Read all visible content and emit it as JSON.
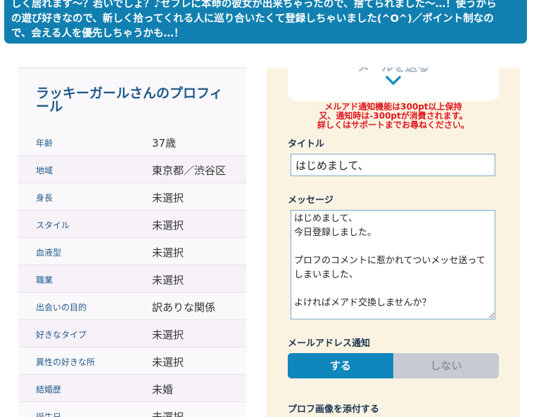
{
  "banner": {
    "line1": "しく居れます〜？若いでしょ？♪セフレに本命の彼女が出来ちゃったので、捨てられました〜…！使うから",
    "line2": "の遊び好きなので、新しく拾ってくれる人に巡り合いたくて登録しちゃいました(^O^)／ポイント制なの",
    "line3": "で、会える人を優先しちゃうかも…！"
  },
  "profile": {
    "heading": "ラッキーガールさんのプロフィール",
    "rows": [
      {
        "key": "年齢",
        "value": "37歳"
      },
      {
        "key": "地域",
        "value": "東京都／渋谷区"
      },
      {
        "key": "身長",
        "value": "未選択"
      },
      {
        "key": "スタイル",
        "value": "未選択"
      },
      {
        "key": "血液型",
        "value": "未選択"
      },
      {
        "key": "職業",
        "value": "未選択"
      },
      {
        "key": "出会いの目的",
        "value": "訳ありな関係"
      },
      {
        "key": "好きなタイプ",
        "value": "未選択"
      },
      {
        "key": "異性の好きな所",
        "value": "未選択"
      },
      {
        "key": "結婚歴",
        "value": "未婚"
      },
      {
        "key": "誕生日",
        "value": "未選択"
      }
    ]
  },
  "mail": {
    "send_label": "メールを送る",
    "notice1": "メルアド通知機能は300pt以上保持",
    "notice2": "又、通知時は-300ptが消費されます。",
    "notice3": "詳しくはサポートまでお尋ねください。",
    "title_label": "タイトル",
    "title_value": "はじめまして、",
    "message_label": "メッセージ",
    "message_value": "はじめまして、\n今日登録しました。\n\nプロフのコメントに惹かれてついメッセ送って\nしまいました、\n\nよければメアド交換しませんか？",
    "notify_label": "メールアドレス通知",
    "notify_on": "する",
    "notify_off": "しない",
    "image_label": "プロフ画像を添付する"
  },
  "colors": {
    "banner": "#1180b0",
    "accent_blue": "#0f87bd",
    "notice_red": "#e0171f",
    "form_bg": "#fbf3e2"
  },
  "icons": {
    "send_chevron": "chevron-down-icon"
  }
}
